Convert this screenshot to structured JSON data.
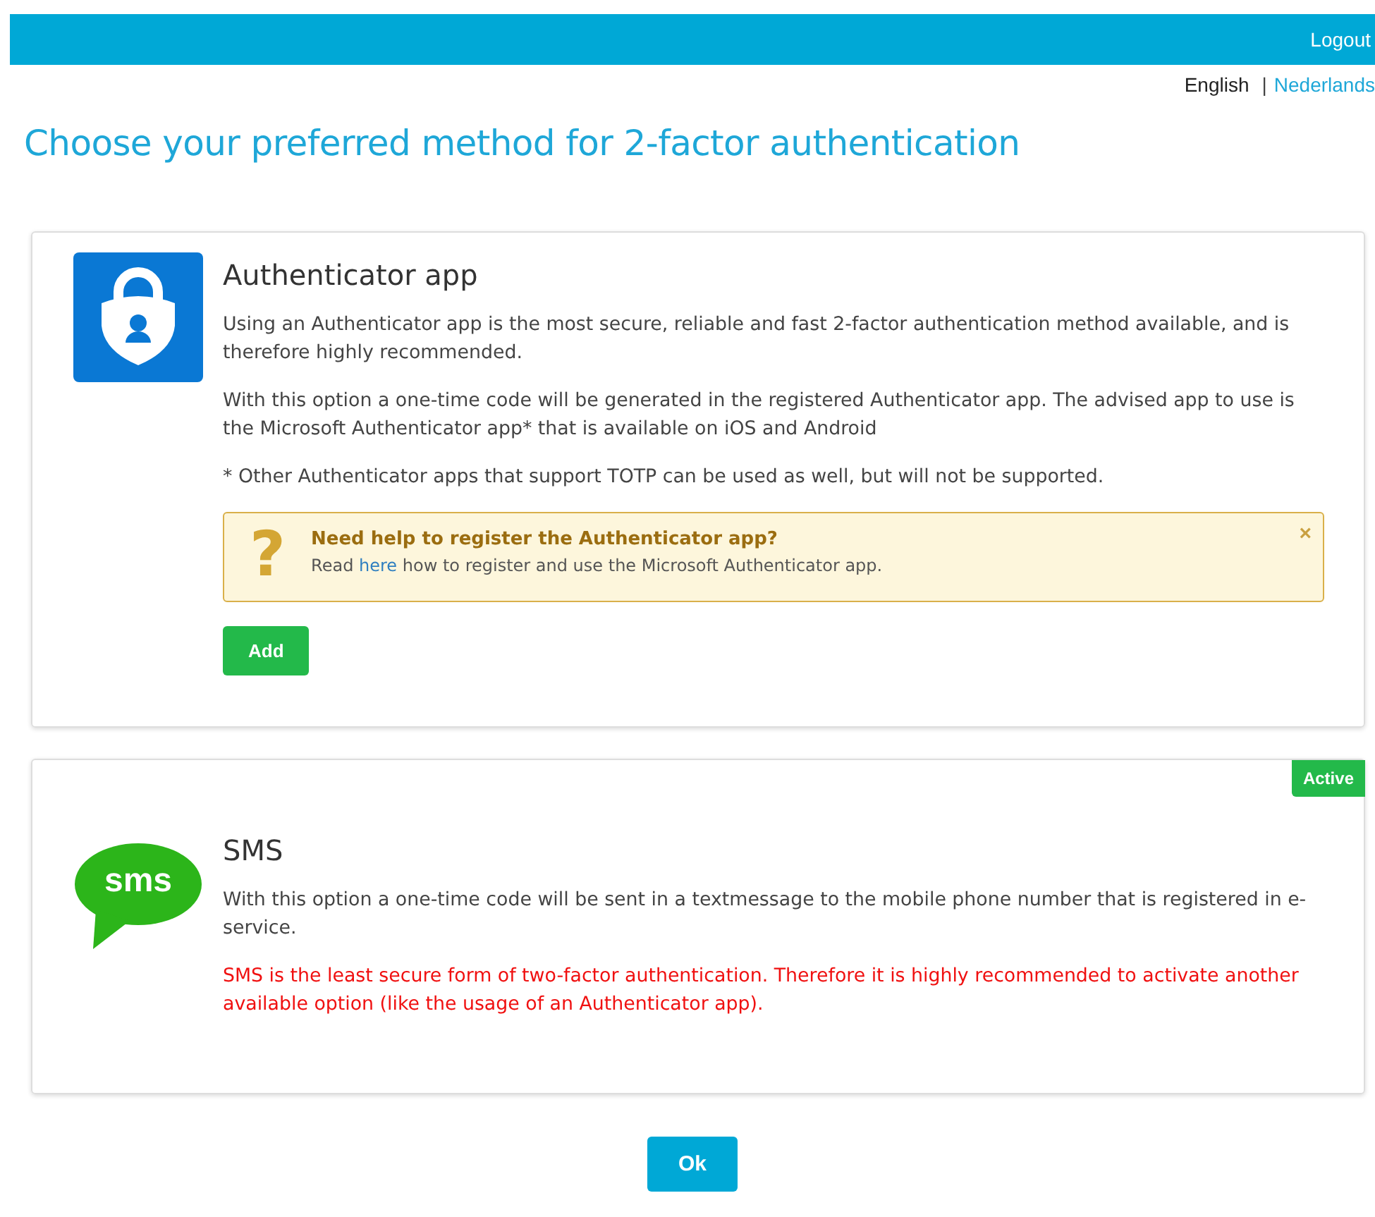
{
  "top_bar": {
    "logout": "Logout"
  },
  "languages": [
    {
      "label": "English",
      "selected": true
    },
    {
      "label": "Nederlands",
      "selected": false
    }
  ],
  "language_separator": "|",
  "title": "Choose your preferred method for 2-factor authentication",
  "methods": [
    {
      "kind": "authenticator",
      "title": "Authenticator app",
      "paragraphs": [
        {
          "kind": "normal",
          "text": "Using an Authenticator app is the most secure, reliable and fast 2-factor authentication method available, and is therefore highly recommended."
        },
        {
          "kind": "normal",
          "text": "With this option a one-time code will be generated in the registered Authenticator app. The advised app to use is the Microsoft Authenticator app* that is available on iOS and Android"
        },
        {
          "kind": "normal",
          "text": "* Other Authenticator apps that support TOTP can be used as well, but will not be supported."
        }
      ],
      "help": {
        "icon": "?",
        "title": "Need help to register the Authenticator app?",
        "before": "Read",
        "link": "here",
        "after": "how to register and use the Microsoft Authenticator app.",
        "close": "×"
      },
      "button": "Add"
    },
    {
      "kind": "sms",
      "icon_text": "sms",
      "title": "SMS",
      "badge": "Active",
      "paragraphs": [
        {
          "kind": "normal",
          "text": "With this option a one-time code will be sent in a textmessage to the mobile phone number that is registered in e-service."
        },
        {
          "kind": "warning",
          "text": "SMS is the least secure form of two-factor authentication. Therefore it is highly recommended to activate another available option (like the usage of an Authenticator app)."
        }
      ]
    }
  ],
  "ok_button": "Ok"
}
